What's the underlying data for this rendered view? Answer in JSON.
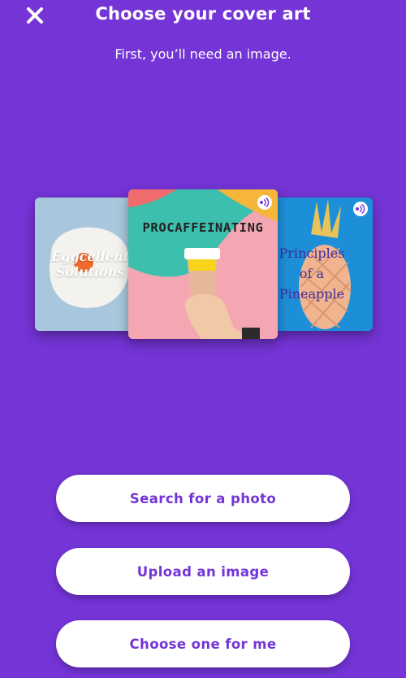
{
  "header": {
    "title": "Choose your cover art",
    "subtitle": "First, you’ll need an image.",
    "close_icon": "close-icon"
  },
  "carousel": {
    "cards": [
      {
        "text": "Eggcellent Solutions"
      },
      {
        "text": "PROCAFFEINATING"
      },
      {
        "text": "Principles of a Pineapple"
      }
    ],
    "badge_icon": "podcast-icon"
  },
  "actions": {
    "search_label": "Search for a photo",
    "upload_label": "Upload an image",
    "choose_label": "Choose one for me"
  },
  "colors": {
    "background": "#7434d6",
    "button_bg": "#ffffff",
    "button_text": "#7434d6"
  }
}
